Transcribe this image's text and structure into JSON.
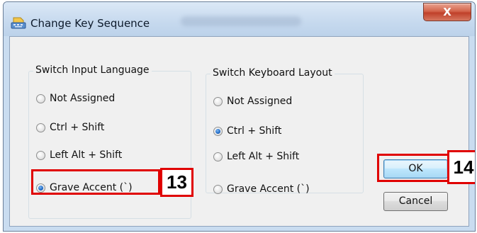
{
  "window": {
    "title": "Change Key Sequence",
    "close_glyph": "X"
  },
  "switch_input_language": {
    "legend": "Switch Input Language",
    "options": [
      {
        "label": "Not Assigned",
        "checked": false
      },
      {
        "label": "Ctrl + Shift",
        "checked": false
      },
      {
        "label": "Left Alt + Shift",
        "checked": false
      },
      {
        "label": "Grave Accent (`)",
        "checked": true
      }
    ]
  },
  "switch_keyboard_layout": {
    "legend": "Switch Keyboard Layout",
    "options": [
      {
        "label": "Not Assigned",
        "checked": false
      },
      {
        "label": "Ctrl + Shift",
        "checked": true
      },
      {
        "label": "Left Alt + Shift",
        "checked": false
      },
      {
        "label": "Grave Accent (`)",
        "checked": false
      }
    ]
  },
  "buttons": {
    "ok": "OK",
    "cancel": "Cancel"
  },
  "callouts": {
    "grave_accent_step": "13",
    "ok_step": "14"
  },
  "colors": {
    "callout_red": "#e00000",
    "radio_selected_blue": "#1f69c5",
    "close_button_red": "#c0402a"
  },
  "icons": {
    "title_icon": "keyboard-icon",
    "close_icon": "close-icon"
  }
}
